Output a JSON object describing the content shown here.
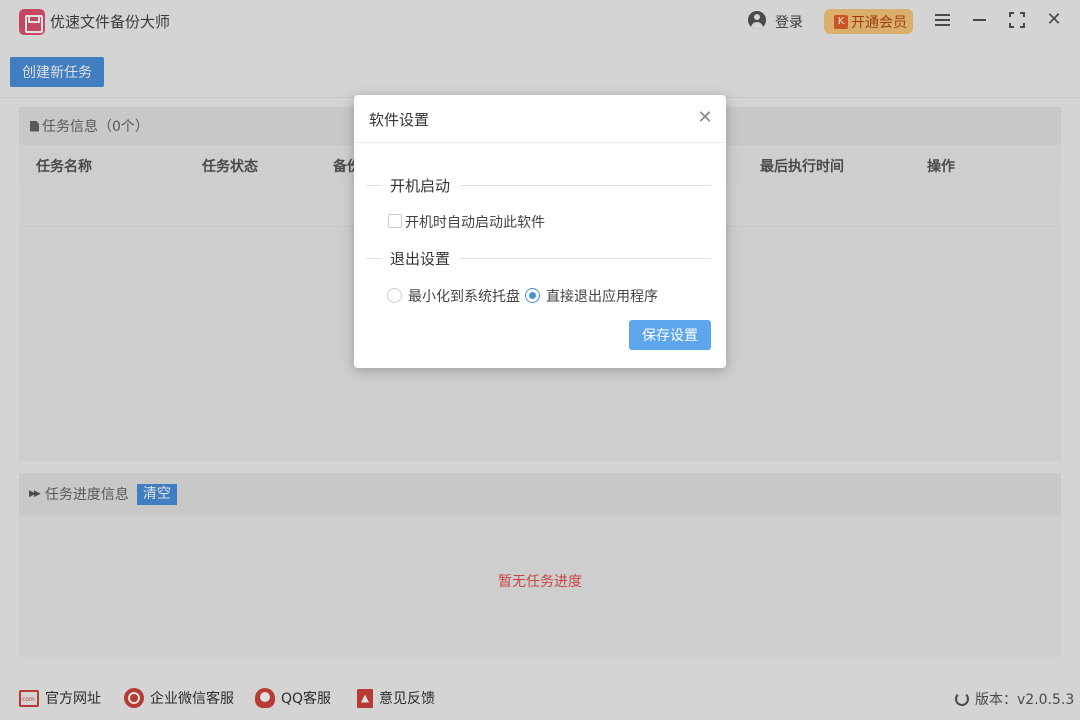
{
  "titlebar": {
    "app_title": "优速文件备份大师",
    "login_label": "登录",
    "vip_label": "开通会员",
    "close_glyph": "✕"
  },
  "toolbar": {
    "create_task_label": "创建新任务"
  },
  "task_panel": {
    "title": "任务信息（0个）",
    "columns": [
      "任务名称",
      "任务状态",
      "备份",
      "最后执行时间",
      "操作"
    ]
  },
  "progress_panel": {
    "title": "任务进度信息",
    "clear_label": "清空",
    "empty_text": "暂无任务进度"
  },
  "footer": {
    "website_label": "官方网址",
    "wechat_label": "企业微信客服",
    "qq_label": "QQ客服",
    "feedback_label": "意见反馈",
    "version_label": "版本：v2.0.5.3"
  },
  "dialog": {
    "title": "软件设置",
    "close_glyph": "✕",
    "startup_section": "开机启动",
    "startup_checkbox_label": "开机时自动启动此软件",
    "startup_checked": false,
    "exit_section": "退出设置",
    "exit_options": [
      {
        "label": "最小化到系统托盘",
        "checked": false
      },
      {
        "label": "直接退出应用程序",
        "checked": true
      }
    ],
    "save_label": "保存设置"
  },
  "colors": {
    "primary": "#4a8fdc",
    "empty_text": "#e0524a",
    "vip_bg": "#f7c87a",
    "icon_red": "#d0443d"
  }
}
